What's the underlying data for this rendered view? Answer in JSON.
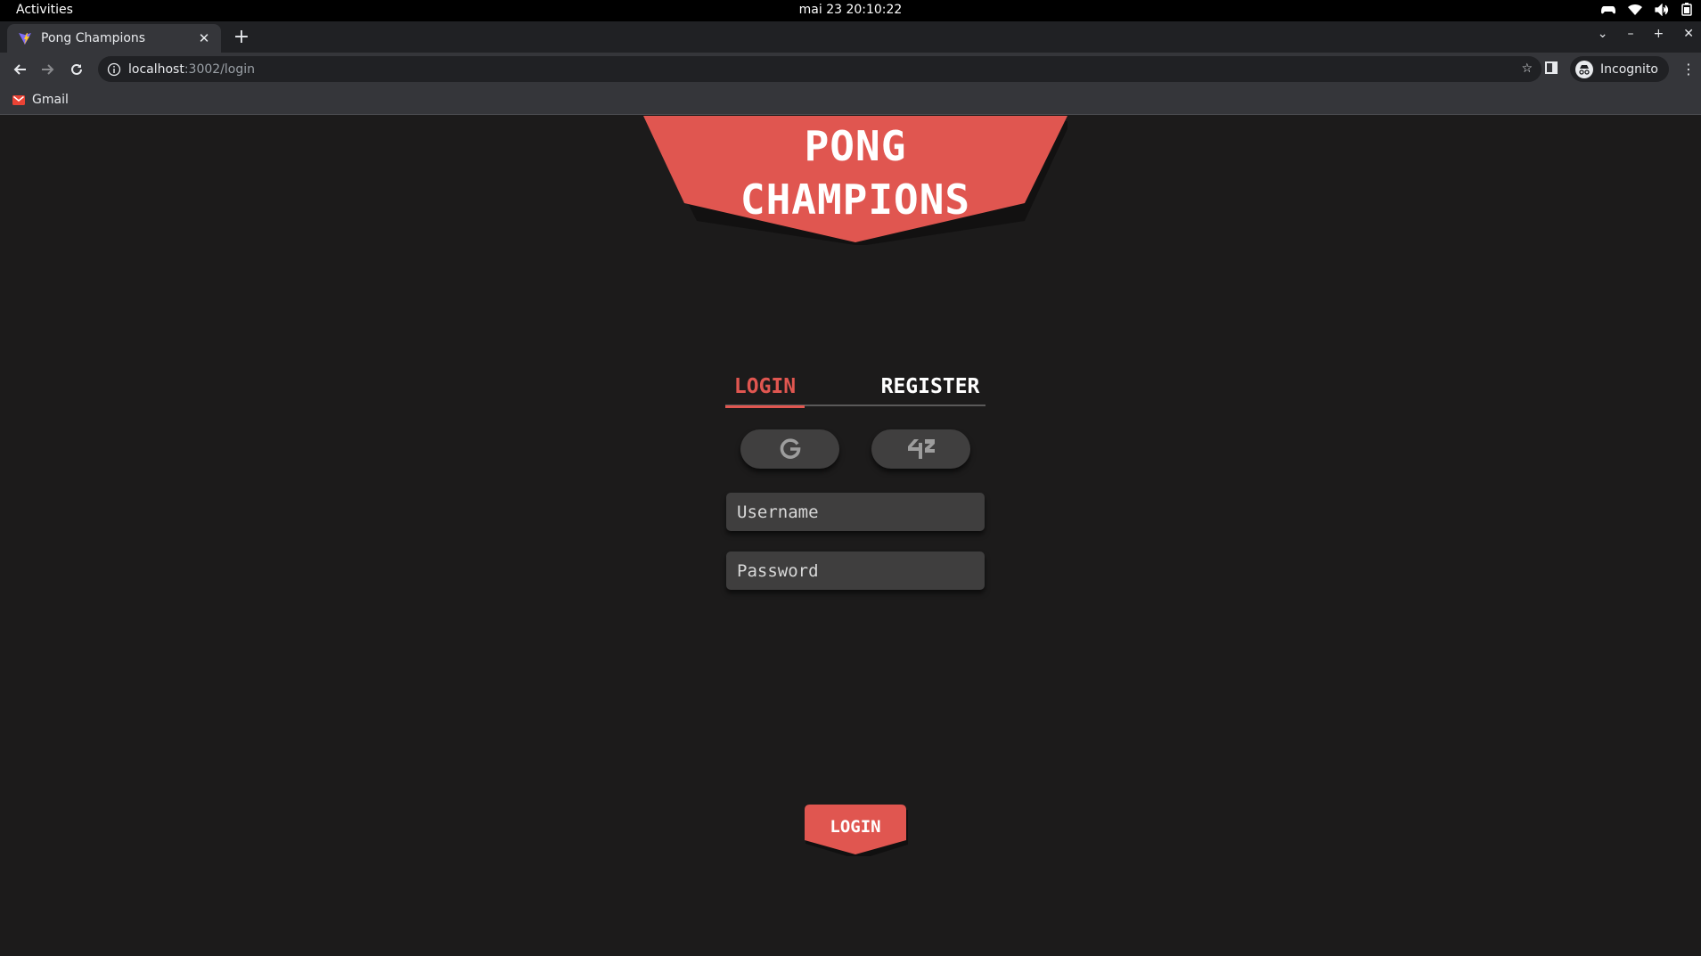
{
  "os": {
    "activities": "Activities",
    "clock": "mai 23  20:10:22"
  },
  "browser": {
    "tab_title": "Pong Champions",
    "url_host": "localhost",
    "url_path": ":3002/login",
    "profile_label": "Incognito",
    "bookmark_gmail": "Gmail"
  },
  "page": {
    "banner_line1": "PONG",
    "banner_line2": "CHAMPIONS",
    "tab_login": "LOGIN",
    "tab_register": "REGISTER",
    "username_placeholder": "Username",
    "password_placeholder": "Password",
    "submit_label": "LOGIN"
  },
  "colors": {
    "accent": "#e05650",
    "background": "#1c1b1b",
    "control": "#403f3f"
  },
  "icons": {
    "oauth_google": "google-g-icon",
    "oauth_42": "forty-two-icon"
  }
}
